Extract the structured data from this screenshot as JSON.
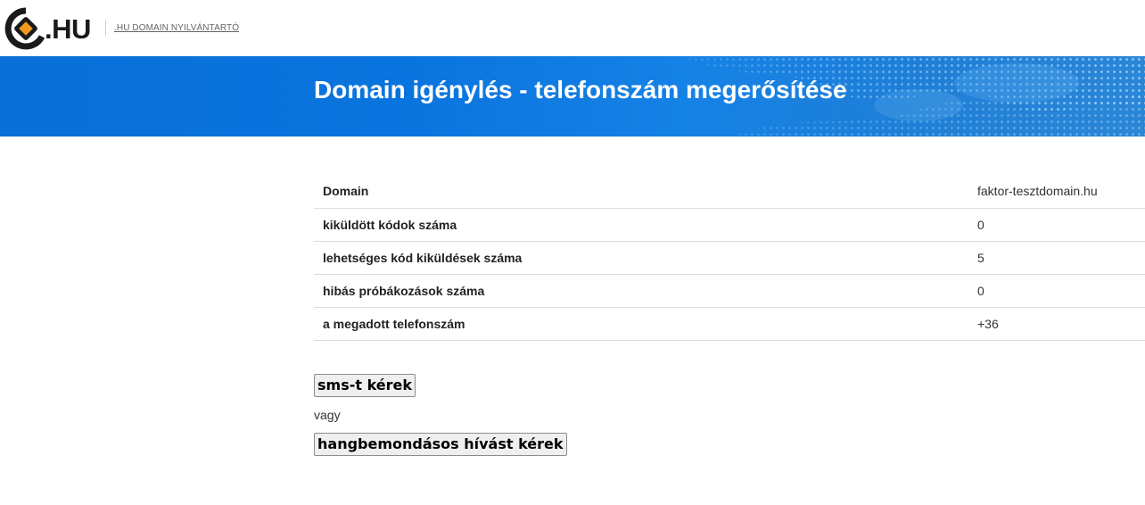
{
  "header": {
    "logo_text": ".HU",
    "nav_link": ".HU DOMAIN NYILVÁNTARTÓ"
  },
  "banner": {
    "title": "Domain igénylés - telefonszám megerősítése"
  },
  "table": {
    "rows": [
      {
        "label": "Domain",
        "value": "faktor-tesztdomain.hu"
      },
      {
        "label": "kiküldött kódok száma",
        "value": "0"
      },
      {
        "label": "lehetséges kód kiküldések száma",
        "value": "5"
      },
      {
        "label": "hibás próbákozások száma",
        "value": "0"
      },
      {
        "label": "a megadott telefonszám",
        "value": "+36"
      }
    ]
  },
  "actions": {
    "sms_button": "sms-t kérek",
    "or_text": "vagy",
    "voice_button": "hangbemondásos hívást kérek"
  },
  "colors": {
    "banner_blue": "#0a6fd8",
    "logo_orange": "#f29a1f"
  }
}
